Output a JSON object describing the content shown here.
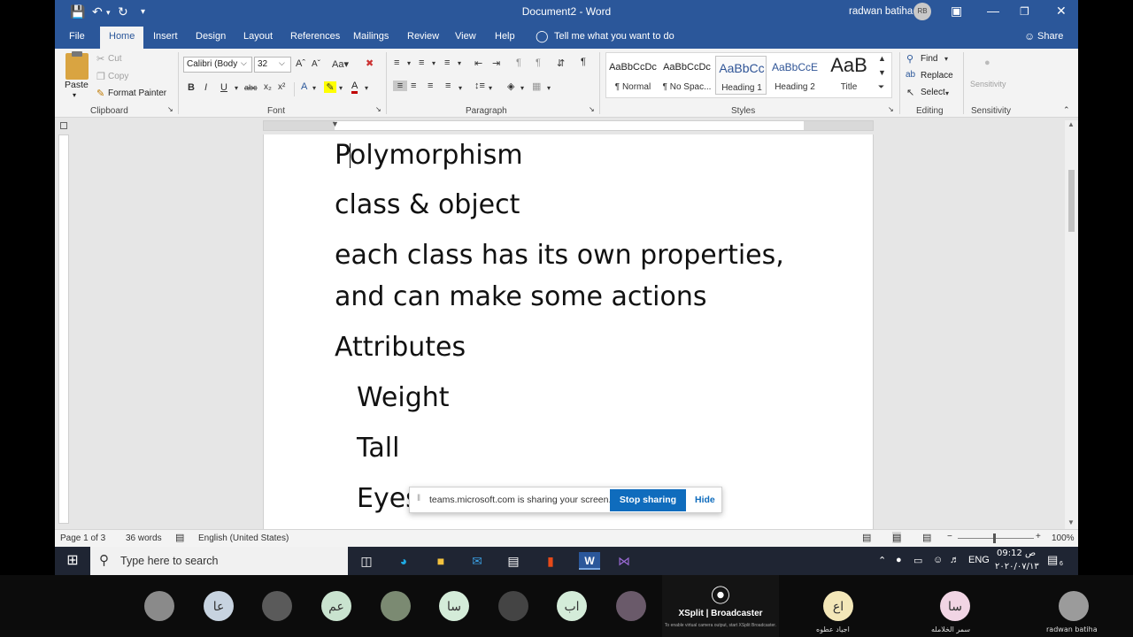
{
  "app": {
    "doc_title": "Document2  -  Word",
    "user_name": "radwan batiha",
    "user_initials": "RB"
  },
  "tabs": [
    "File",
    "Home",
    "Insert",
    "Design",
    "Layout",
    "References",
    "Mailings",
    "Review",
    "View",
    "Help"
  ],
  "tell_me": "Tell me what you want to do",
  "share_label": "Share",
  "clipboard": {
    "paste": "Paste",
    "cut": "Cut",
    "copy": "Copy",
    "format_painter": "Format Painter",
    "label": "Clipboard"
  },
  "font": {
    "name": "Calibri (Body",
    "size": "32",
    "label": "Font"
  },
  "paragraph": {
    "label": "Paragraph"
  },
  "styles": {
    "label": "Styles",
    "items": [
      {
        "sample": "AaBbCcDc",
        "name": "¶ Normal"
      },
      {
        "sample": "AaBbCcDc",
        "name": "¶ No Spac..."
      },
      {
        "sample": "AaBbCc",
        "name": "Heading 1"
      },
      {
        "sample": "AaBbCcE",
        "name": "Heading 2"
      },
      {
        "sample": "AaB",
        "name": "Title"
      }
    ]
  },
  "editing": {
    "find": "Find",
    "replace": "Replace",
    "select": "Select",
    "label": "Editing"
  },
  "sensitivity": {
    "button": "Sensitivity",
    "label": "Sensitivity"
  },
  "document": {
    "lines": [
      "Polymorphism",
      "class   & object",
      "each class has its own properties,",
      "and can make some actions",
      "Attributes",
      "Weight",
      "Tall",
      "Eyes"
    ]
  },
  "share_notice": {
    "message": "teams.microsoft.com is sharing your screen.",
    "stop": "Stop sharing",
    "hide": "Hide"
  },
  "status": {
    "page": "Page 1 of 3",
    "words": "36 words",
    "language": "English (United States)",
    "zoom": "100%"
  },
  "taskbar": {
    "search_placeholder": "Type here to search",
    "lang": "ENG",
    "time": "09:12 ص",
    "date": "٢٠٢٠/٠٧/١٣",
    "notif_count": "6"
  },
  "participants": [
    {
      "initials": "",
      "name": "",
      "color": "#8a8a8a"
    },
    {
      "initials": "عا",
      "name": "",
      "color": "#c7d3e0"
    },
    {
      "initials": "",
      "name": "",
      "color": "#5a5a5a"
    },
    {
      "initials": "عم",
      "name": "",
      "color": "#c9e3cf"
    },
    {
      "initials": "",
      "name": "",
      "color": "#7b8a72"
    },
    {
      "initials": "سا",
      "name": "",
      "color": "#d4ecd9"
    },
    {
      "initials": "",
      "name": "",
      "color": "#444444"
    },
    {
      "initials": "اب",
      "name": "",
      "color": "#d4ecd9"
    },
    {
      "initials": "",
      "name": "",
      "color": "#6a5a6a"
    },
    {
      "initials": "اع",
      "name": "اجياد عطوه",
      "color": "#f3e7b8"
    },
    {
      "initials": "سا",
      "name": "سمر الخلامله",
      "color": "#f1d5e4"
    },
    {
      "initials": "",
      "name": "radwan batiha",
      "color": "#9b9b9b"
    }
  ],
  "xsplit": {
    "title": "XSplit | Broadcaster",
    "subtitle": "To enable virtual camera output, start XSplit Broadcaster."
  },
  "colors": {
    "word_blue": "#2b579a",
    "teams_blue": "#0f6cbd",
    "page_bg": "#e6e6e6"
  }
}
